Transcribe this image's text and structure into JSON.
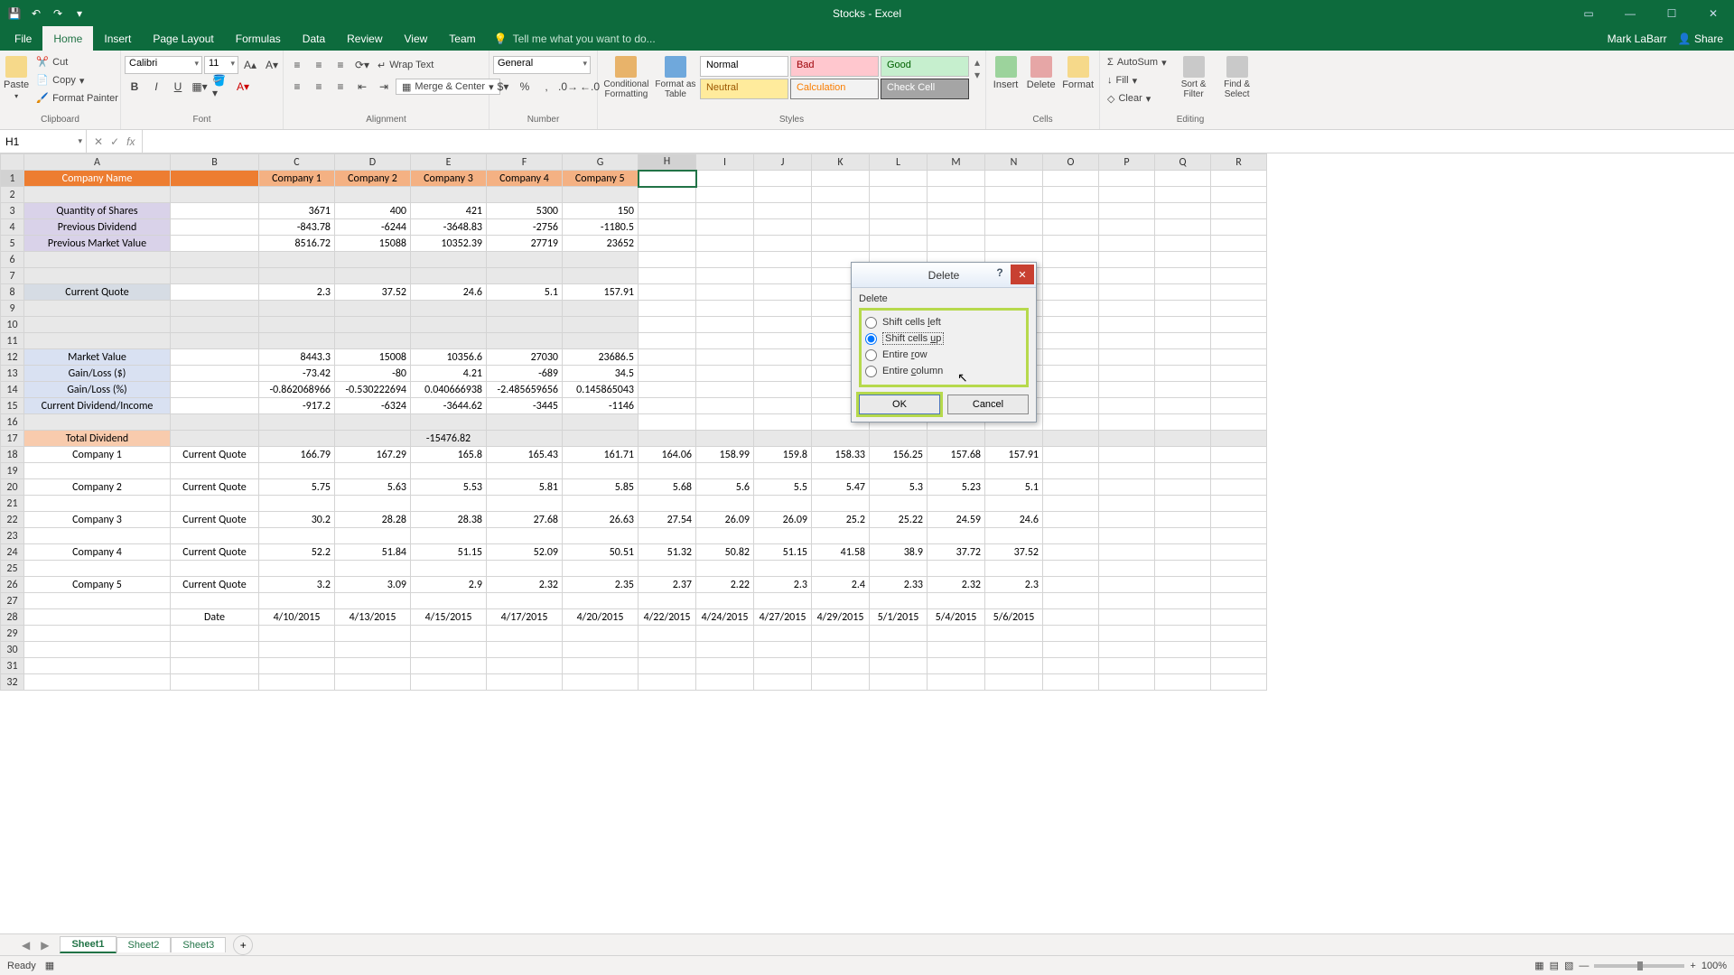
{
  "app": {
    "title": "Stocks - Excel",
    "user": "Mark LaBarr",
    "share": "Share"
  },
  "tabs": {
    "file": "File",
    "home": "Home",
    "insert": "Insert",
    "pagelayout": "Page Layout",
    "formulas": "Formulas",
    "data": "Data",
    "review": "Review",
    "view": "View",
    "team": "Team",
    "tellme": "Tell me what you want to do..."
  },
  "clipboard": {
    "cut": "Cut",
    "copy": "Copy",
    "painter": "Format Painter",
    "paste": "Paste",
    "label": "Clipboard"
  },
  "font": {
    "name": "Calibri",
    "size": "11",
    "label": "Font"
  },
  "alignment": {
    "wrap": "Wrap Text",
    "merge": "Merge & Center",
    "label": "Alignment"
  },
  "number": {
    "format": "General",
    "label": "Number"
  },
  "styles": {
    "cond": "Conditional Formatting",
    "fmtas": "Format as Table",
    "normal": "Normal",
    "bad": "Bad",
    "good": "Good",
    "neutral": "Neutral",
    "calc": "Calculation",
    "check": "Check Cell",
    "label": "Styles"
  },
  "cells": {
    "insert": "Insert",
    "delete": "Delete",
    "format": "Format",
    "label": "Cells"
  },
  "editing": {
    "sum": "AutoSum",
    "fill": "Fill",
    "clear": "Clear",
    "sort": "Sort & Filter",
    "find": "Find & Select",
    "label": "Editing"
  },
  "namebox": "H1",
  "status": {
    "ready": "Ready",
    "zoom": "100%"
  },
  "sheets": [
    "Sheet1",
    "Sheet2",
    "Sheet3"
  ],
  "dialog": {
    "title": "Delete",
    "legend": "Delete",
    "opt1": "Shift cells left",
    "opt2": "Shift cells up",
    "opt3": "Entire row",
    "opt4": "Entire column",
    "ok": "OK",
    "cancel": "Cancel"
  },
  "cols": [
    "A",
    "B",
    "C",
    "D",
    "E",
    "F",
    "G",
    "H",
    "I",
    "J",
    "K",
    "L",
    "M",
    "N",
    "O",
    "P",
    "Q",
    "R"
  ],
  "chart_data": {
    "type": "table",
    "row1": {
      "A": "Company Name",
      "C": "Company 1",
      "D": "Company 2",
      "E": "Company 3",
      "F": "Company 4",
      "G": "Company 5"
    },
    "row3": {
      "A": "Quantity of Shares",
      "C": "3671",
      "D": "400",
      "E": "421",
      "F": "5300",
      "G": "150"
    },
    "row4": {
      "A": "Previous Dividend",
      "C": "-843.78",
      "D": "-6244",
      "E": "-3648.83",
      "F": "-2756",
      "G": "-1180.5"
    },
    "row5": {
      "A": "Previous Market Value",
      "C": "8516.72",
      "D": "15088",
      "E": "10352.39",
      "F": "27719",
      "G": "23652"
    },
    "row8": {
      "A": "Current Quote",
      "C": "2.3",
      "D": "37.52",
      "E": "24.6",
      "F": "5.1",
      "G": "157.91"
    },
    "row12": {
      "A": "Market Value",
      "C": "8443.3",
      "D": "15008",
      "E": "10356.6",
      "F": "27030",
      "G": "23686.5"
    },
    "row13": {
      "A": "Gain/Loss ($)",
      "C": "-73.42",
      "D": "-80",
      "E": "4.21",
      "F": "-689",
      "G": "34.5"
    },
    "row14": {
      "A": "Gain/Loss (%)",
      "C": "-0.862068966",
      "D": "-0.530222694",
      "E": "0.040666938",
      "F": "-2.485659656",
      "G": "0.145865043"
    },
    "row15": {
      "A": "Current Dividend/Income",
      "C": "-917.2",
      "D": "-6324",
      "E": "-3644.62",
      "F": "-3445",
      "G": "-1146"
    },
    "row17": {
      "A": "Total Dividend",
      "E": "-15476.82"
    },
    "row18": {
      "A": "Company 1",
      "B": "Current Quote",
      "C": "166.79",
      "D": "167.29",
      "E": "165.8",
      "F": "165.43",
      "G": "161.71",
      "H": "164.06",
      "I": "158.99",
      "J": "159.8",
      "K": "158.33",
      "L": "156.25",
      "M": "157.68",
      "N": "157.91"
    },
    "row20": {
      "A": "Company 2",
      "B": "Current Quote",
      "C": "5.75",
      "D": "5.63",
      "E": "5.53",
      "F": "5.81",
      "G": "5.85",
      "H": "5.68",
      "I": "5.6",
      "J": "5.5",
      "K": "5.47",
      "L": "5.3",
      "M": "5.23",
      "N": "5.1"
    },
    "row22": {
      "A": "Company 3",
      "B": "Current Quote",
      "C": "30.2",
      "D": "28.28",
      "E": "28.38",
      "F": "27.68",
      "G": "26.63",
      "H": "27.54",
      "I": "26.09",
      "J": "26.09",
      "K": "25.2",
      "L": "25.22",
      "M": "24.59",
      "N": "24.6"
    },
    "row24": {
      "A": "Company 4",
      "B": "Current Quote",
      "C": "52.2",
      "D": "51.84",
      "E": "51.15",
      "F": "52.09",
      "G": "50.51",
      "H": "51.32",
      "I": "50.82",
      "J": "51.15",
      "K": "41.58",
      "L": "38.9",
      "M": "37.72",
      "N": "37.52"
    },
    "row26": {
      "A": "Company 5",
      "B": "Current Quote",
      "C": "3.2",
      "D": "3.09",
      "E": "2.9",
      "F": "2.32",
      "G": "2.35",
      "H": "2.37",
      "I": "2.22",
      "J": "2.3",
      "K": "2.4",
      "L": "2.33",
      "M": "2.32",
      "N": "2.3"
    },
    "row28": {
      "B": "Date",
      "C": "4/10/2015",
      "D": "4/13/2015",
      "E": "4/15/2015",
      "F": "4/17/2015",
      "G": "4/20/2015",
      "H": "4/22/2015",
      "I": "4/24/2015",
      "J": "4/27/2015",
      "K": "4/29/2015",
      "L": "5/1/2015",
      "M": "5/4/2015",
      "N": "5/6/2015"
    }
  }
}
